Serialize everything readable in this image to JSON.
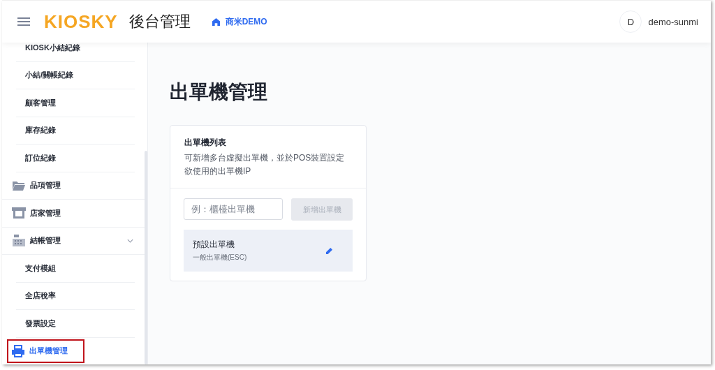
{
  "header": {
    "logo": "KIOSKY",
    "title": "後台管理",
    "store": "商米DEMO",
    "avatar": "D",
    "user": "demo-sunmi"
  },
  "sidebar": {
    "items": [
      {
        "label": "KIOSK小結紀錄",
        "kind": "sub",
        "selected": false
      },
      {
        "label": "小結/關帳紀錄",
        "kind": "sub",
        "selected": false
      },
      {
        "label": "顧客管理",
        "kind": "sub",
        "selected": false
      },
      {
        "label": "庫存紀錄",
        "kind": "sub",
        "selected": false
      },
      {
        "label": "訂位紀錄",
        "kind": "sub",
        "selected": false
      },
      {
        "label": "品項管理",
        "kind": "folder",
        "selected": false
      },
      {
        "label": "店家管理",
        "kind": "store",
        "selected": false
      },
      {
        "label": "結帳管理",
        "kind": "register",
        "selected": false,
        "expanded": true
      },
      {
        "label": "支付模組",
        "kind": "sub",
        "selected": false
      },
      {
        "label": "全店稅率",
        "kind": "sub",
        "selected": false
      },
      {
        "label": "發票設定",
        "kind": "sub",
        "selected": false
      },
      {
        "label": "出單機管理",
        "kind": "printer",
        "selected": true
      }
    ]
  },
  "page": {
    "title": "出單機管理",
    "card": {
      "title": "出單機列表",
      "description": "可新增多台虛擬出單機，並於POS裝置設定欲使用的出單機IP",
      "name_field": {
        "placeholder": "例：櫃檯出單機"
      },
      "add_button": {
        "label": "新增出單機",
        "disabled": true
      },
      "printers": [
        {
          "name": "預設出單機",
          "type": "一般出單機(ESC)"
        }
      ]
    }
  }
}
